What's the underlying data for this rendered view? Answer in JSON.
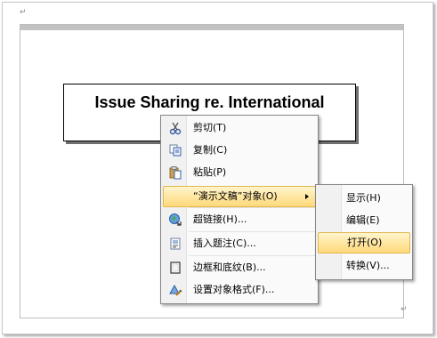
{
  "document": {
    "paragraph_mark_top": "↵",
    "paragraph_mark_bottom": "↵",
    "slide_title": "Issue Sharing re. International"
  },
  "context_menu": {
    "items": [
      {
        "label": "剪切(T)",
        "icon": "scissors-icon"
      },
      {
        "label": "复制(C)",
        "icon": "copy-icon"
      },
      {
        "label": "粘贴(P)",
        "icon": "paste-icon"
      },
      {
        "label": "“演示文稿”对象(O)",
        "icon": ""
      },
      {
        "label": "超链接(H)...",
        "icon": "hyperlink-globe-icon"
      },
      {
        "label": "插入题注(C)...",
        "icon": "caption-icon"
      },
      {
        "label": "边框和底纹(B)...",
        "icon": "border-icon"
      },
      {
        "label": "设置对象格式(F)...",
        "icon": "format-object-icon"
      }
    ]
  },
  "sub_menu": {
    "items": [
      {
        "label": "显示(H)"
      },
      {
        "label": "编辑(E)"
      },
      {
        "label": "打开(O)"
      },
      {
        "label": "转换(V)..."
      }
    ]
  },
  "colors": {
    "highlight_top": "#fff5cc",
    "highlight_bottom": "#ffd97a",
    "highlight_border": "#e3b650"
  }
}
